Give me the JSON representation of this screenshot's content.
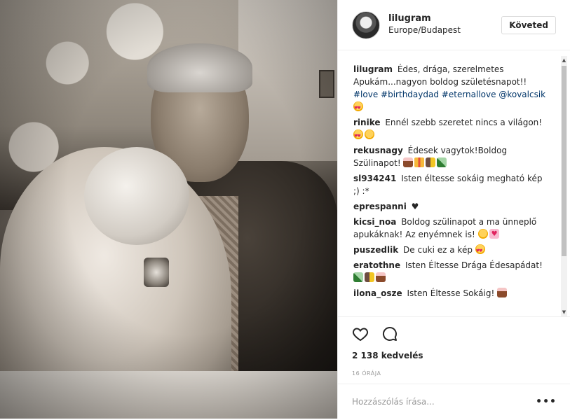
{
  "post": {
    "username": "lilugram",
    "location": "Europe/Budapest",
    "follow_label": "Követed",
    "likes": "2 138 kedvelés",
    "time": "16 ÓRÁJA",
    "comment_placeholder": "Hozzászólás írása...",
    "more_label": "•••"
  },
  "caption": {
    "user": "lilugram",
    "text": "Édes, drága, szerelmetes Apukám...nagyon boldog születésnapot!!",
    "tags": [
      "#love",
      "#birthdaydad",
      "#eternallove"
    ],
    "mention": "@kovalcsik"
  },
  "comments": [
    {
      "user": "rinike",
      "text": "Ennél szebb szeretet nincs a világon!"
    },
    {
      "user": "rekusnagy",
      "text": "Édesek vagytok!Boldog Szülinapot!"
    },
    {
      "user": "sl934241",
      "text": "Isten éltesse sokáig megható kép ;) :*"
    },
    {
      "user": "eprespanni",
      "text": "♥"
    },
    {
      "user": "kicsi_noa",
      "text": "Boldog szülinapot a ma ünneplő apukáknak! Az enyémnek is!"
    },
    {
      "user": "puszedlik",
      "text": "De cuki ez a kép"
    },
    {
      "user": "eratothne",
      "text": "Isten Éltesse Drága Édesapádat!"
    },
    {
      "user": "ilona_osze",
      "text": "Isten Éltesse Sokáig!"
    }
  ],
  "icons": [
    "heart-icon",
    "comment-icon",
    "more-icon"
  ]
}
